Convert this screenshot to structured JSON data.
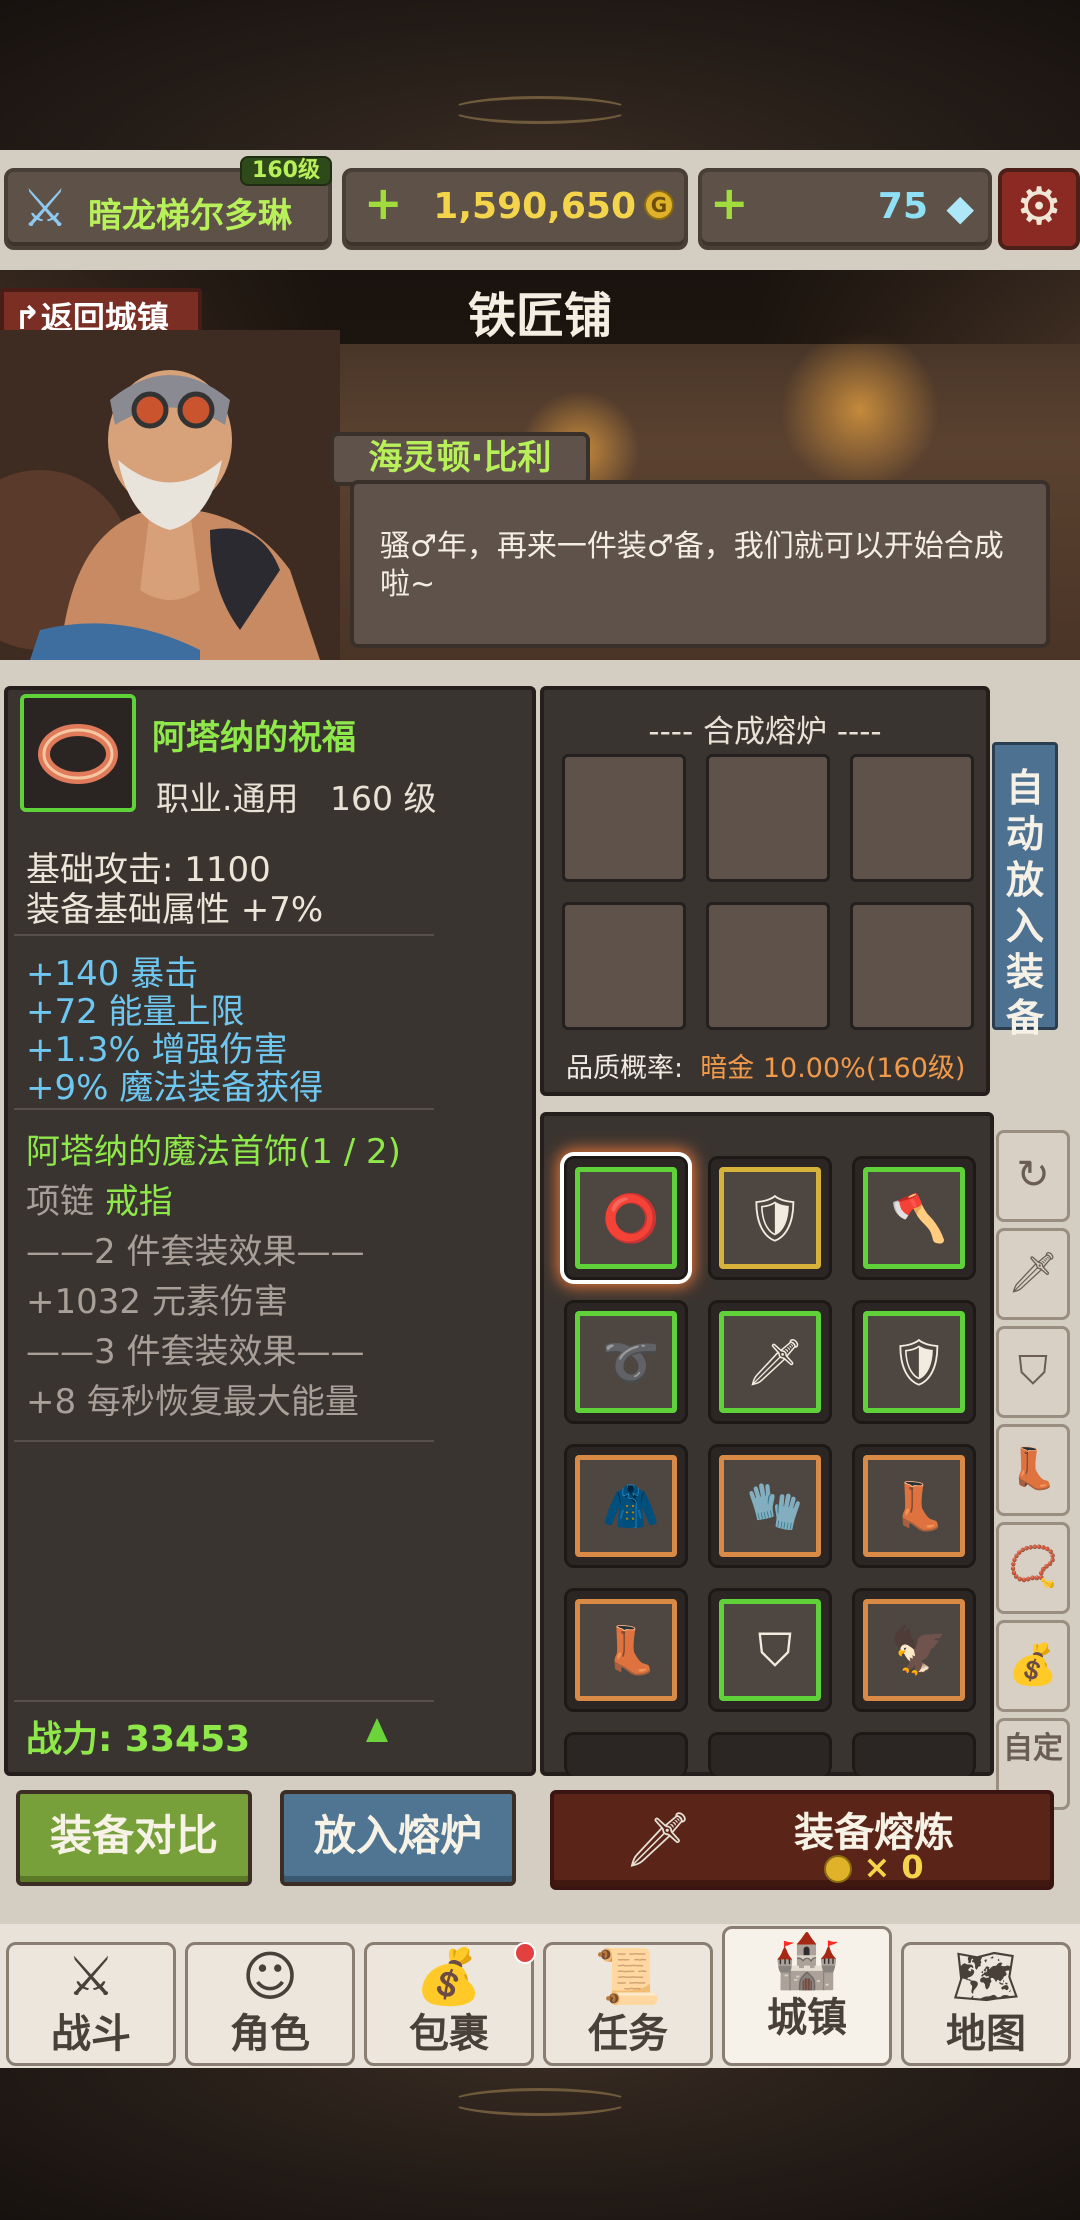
{
  "player": {
    "level_badge": "160级",
    "name": "暗龙梯尔多琳"
  },
  "currency": {
    "gold": "1,590,650",
    "gems": "75",
    "plus": "+"
  },
  "scene": {
    "title": "铁匠铺",
    "back_label": "返回城镇",
    "npc_name": "海灵顿·比利",
    "dialog": "骚♂年，再来一件装♂备，我们就可以开始合成啦~"
  },
  "item": {
    "name": "阿塔纳的祝福",
    "class": "职业.通用",
    "level": "160 级",
    "base_attack": "基础攻击:  1100",
    "base_bonus": "装备基础属性 +7%",
    "bonuses": [
      "+140 暴击",
      "+72 能量上限",
      "+1.3% 增强伤害",
      "+9% 魔法装备获得"
    ],
    "set_name": "阿塔纳的魔法首饰(1 / 2)",
    "set_pieces": [
      "项链",
      "戒指"
    ],
    "set2_header": "——2 件套装效果——",
    "set2_effect": "+1032 元素伤害",
    "set3_header": "——3 件套装效果——",
    "set3_effect": "+8 每秒恢复最大能量",
    "power": "战力:  33453"
  },
  "furnace": {
    "title": "---- 合成熔炉 ----",
    "quality_label": "品质概率:",
    "quality_value": "暗金 10.00%(160级)",
    "auto_label": "自动放入装备"
  },
  "inventory": [
    {
      "icon": "ring-icon",
      "glyph": "⭕",
      "frame": "green",
      "selected": true
    },
    {
      "icon": "armor-icon",
      "glyph": "🛡",
      "frame": "gold"
    },
    {
      "icon": "axe-icon",
      "glyph": "🪓",
      "frame": "green"
    },
    {
      "icon": "belt-icon",
      "glyph": "➰",
      "frame": "green"
    },
    {
      "icon": "sword-icon",
      "glyph": "🗡",
      "frame": "green"
    },
    {
      "icon": "shield-icon",
      "glyph": "🛡",
      "frame": "green"
    },
    {
      "icon": "chest-armor-icon",
      "glyph": "🧥",
      "frame": "orange"
    },
    {
      "icon": "gauntlet-icon",
      "glyph": "🧤",
      "frame": "orange"
    },
    {
      "icon": "boots-icon",
      "glyph": "👢",
      "frame": "orange"
    },
    {
      "icon": "boots-icon",
      "glyph": "👢",
      "frame": "orange"
    },
    {
      "icon": "tower-shield-icon",
      "glyph": "⛉",
      "frame": "green"
    },
    {
      "icon": "claw-icon",
      "glyph": "🦅",
      "frame": "orange"
    }
  ],
  "filters": [
    {
      "icon": "refresh-icon",
      "glyph": "↻"
    },
    {
      "icon": "weapon-filter-icon",
      "glyph": "🗡"
    },
    {
      "icon": "shield-filter-icon",
      "glyph": "⛉"
    },
    {
      "icon": "boots-filter-icon",
      "glyph": "👢"
    },
    {
      "icon": "necklace-filter-icon",
      "glyph": "📿"
    },
    {
      "icon": "bag-filter-icon",
      "glyph": "💰"
    },
    {
      "icon": "custom-filter",
      "label": "自定"
    }
  ],
  "actions": {
    "compare": "装备对比",
    "put_in": "放入熔炉",
    "smelt": "装备熔炼",
    "smelt_cost": "× 0"
  },
  "nav": [
    {
      "label": "战斗",
      "icon": "swords-icon",
      "glyph": "⚔"
    },
    {
      "label": "角色",
      "icon": "character-icon",
      "glyph": "☺"
    },
    {
      "label": "包裹",
      "icon": "bag-icon",
      "glyph": "💰"
    },
    {
      "label": "任务",
      "icon": "quest-icon",
      "glyph": "📜"
    },
    {
      "label": "城镇",
      "icon": "castle-icon",
      "glyph": "🏰"
    },
    {
      "label": "地图",
      "icon": "map-icon",
      "glyph": "🗺"
    }
  ],
  "colors": {
    "accent_green": "#8ee84a",
    "gold": "#f4d44a",
    "blue_stat": "#6ec7f0",
    "quality_orange": "#f09a4a"
  }
}
